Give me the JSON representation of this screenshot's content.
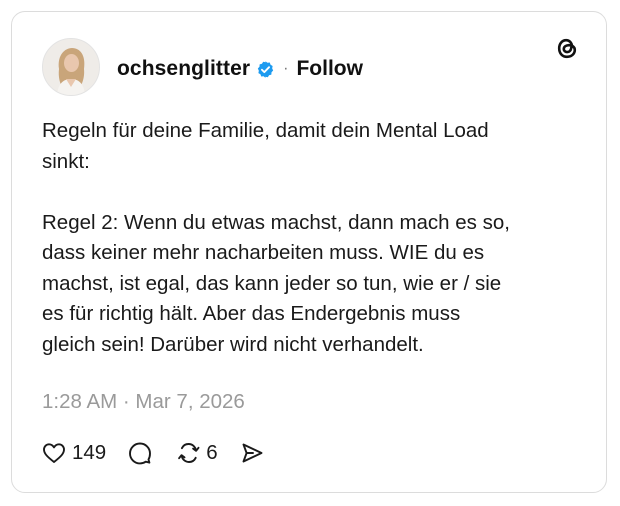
{
  "post": {
    "username": "ochsenglitter",
    "verified": true,
    "separator": "·",
    "follow_label": "Follow",
    "text": "Regeln für deine Familie, damit dein Mental Load\nsinkt:\n\nRegel 2: Wenn du etwas machst, dann mach es so,\ndass keiner mehr nacharbeiten muss. WIE du es\nmachst, ist egal, das kann jeder so tun, wie er / sie\nes für richtig hält. Aber das Endergebnis muss\ngleich sein! Darüber wird nicht verhandelt.",
    "timestamp": "1:28 AM · Mar 7, 2026"
  },
  "actions": {
    "like_count": "149",
    "repost_count": "6"
  },
  "icons": {
    "verified": "verified-badge-icon",
    "logo": "threads-logo-icon",
    "like": "heart-icon",
    "reply": "reply-bubble-icon",
    "repost": "repost-icon",
    "share": "send-icon"
  },
  "colors": {
    "verified_badge": "#1d9bf0",
    "text": "#1a1a1a",
    "muted": "#9a9a9a",
    "border": "#dcdcdc"
  }
}
